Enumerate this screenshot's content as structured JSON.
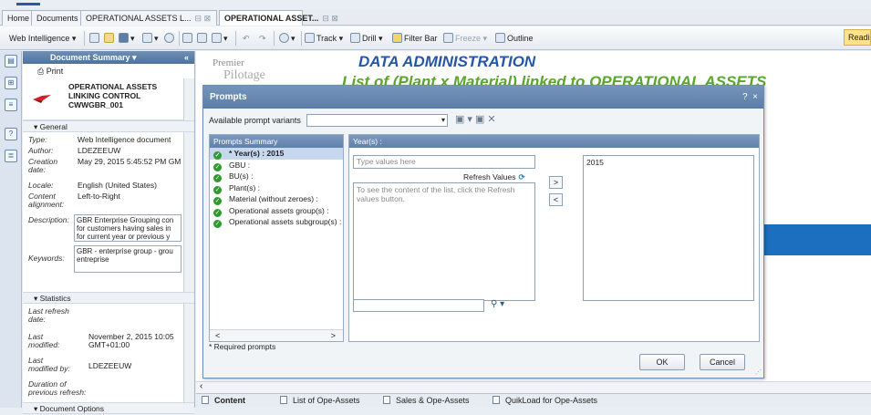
{
  "tabs": {
    "home": "Home",
    "documents": "Documents",
    "tab1": "OPERATIONAL ASSETS L...",
    "tab2": "OPERATIONAL ASSET..."
  },
  "toolbar": {
    "app_menu": "Web Intelligence",
    "track": "Track",
    "drill": "Drill",
    "filter_bar": "Filter Bar",
    "freeze": "Freeze",
    "outline": "Outline",
    "reading": "Readi"
  },
  "panel": {
    "title": "Document Summary",
    "print": "Print",
    "doc_title": "OPERATIONAL ASSETS LINKING CONTROL CWWGBR_001",
    "general_section": "General",
    "type_k": "Type:",
    "type_v": "Web Intelligence document",
    "author_k": "Author:",
    "author_v": "LDEZEEUW",
    "creation_k": "Creation date:",
    "creation_v": "May 29, 2015 5:45:52 PM GM",
    "locale_k": "Locale:",
    "locale_v": "English (United States)",
    "content_k": "Content alignment:",
    "content_v": "Left-to-Right",
    "desc_k": "Description:",
    "desc_lines": [
      "GBR Enterprise Grouping con",
      "for customers having sales in",
      "for current year or previous y"
    ],
    "keywords_k": "Keywords:",
    "keywords_lines": [
      "GBR - enterprise group - grou",
      "entreprise"
    ],
    "statistics_section": "Statistics",
    "last_refresh_k": "Last refresh date:",
    "last_modified_k": "Last modified:",
    "last_modified_v": "November 2, 2015 10:05 GMT+01:00",
    "last_modified_by_k": "Last modified by:",
    "last_modified_by_v": "LDEZEEUW",
    "duration_k": "Duration of previous refresh:",
    "doc_options_section": "Document Options"
  },
  "report": {
    "logo_line1": "Premier",
    "logo_line2": "Pilotage",
    "title1": "DATA ADMINISTRATION",
    "title2": "List of (Plant x Material) linked to OPERATIONAL ASSETS"
  },
  "dialog": {
    "title": "Prompts",
    "help": "?",
    "close": "×",
    "variants_label": "Available prompt variants",
    "summary_header": "Prompts Summary",
    "prompts": [
      {
        "label": "* Year(s) : 2015"
      },
      {
        "label": "GBU :"
      },
      {
        "label": "BU(s) :"
      },
      {
        "label": "Plant(s) :"
      },
      {
        "label": "Material (without zeroes) :"
      },
      {
        "label": "Operational assets group(s) :"
      },
      {
        "label": "Operational assets subgroup(s) :"
      }
    ],
    "right_header": "Year(s) :",
    "type_placeholder": "Type values here",
    "refresh_values": "Refresh Values",
    "list_hint": "To see the content of the list, click the Refresh values button.",
    "add_btn": ">",
    "remove_btn": "<",
    "selected_value": "2015",
    "required_note": "* Required prompts",
    "ok": "OK",
    "cancel": "Cancel"
  },
  "bottom_tabs": [
    "Content",
    "List of Ope-Assets",
    "Sales & Ope-Assets",
    "QuikLoad for Ope-Assets"
  ]
}
